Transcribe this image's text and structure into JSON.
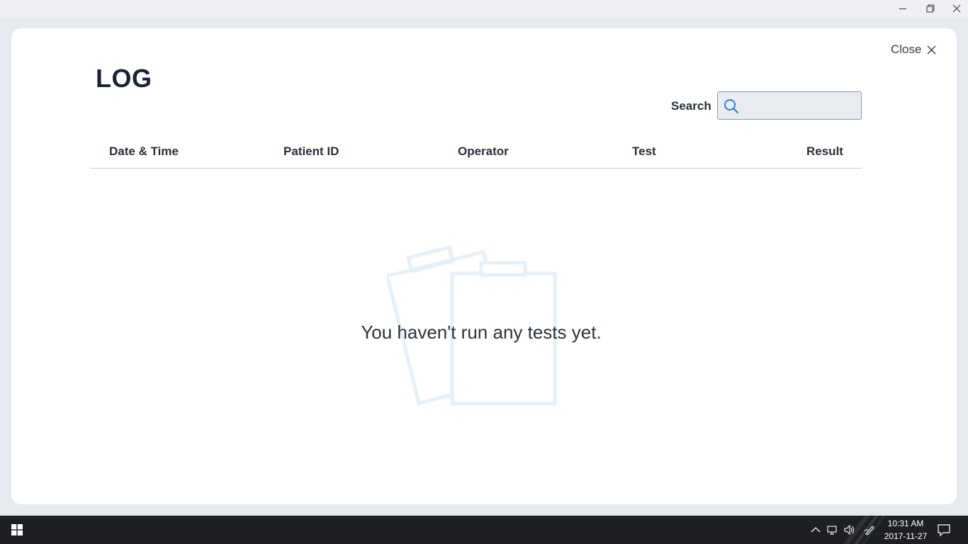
{
  "window": {
    "controls": [
      "minimize",
      "restore",
      "close"
    ]
  },
  "modal": {
    "close_label": "Close",
    "title": "LOG",
    "search": {
      "label": "Search",
      "value": "",
      "placeholder": ""
    },
    "table": {
      "columns": [
        "Date & Time",
        "Patient ID",
        "Operator",
        "Test",
        "Result"
      ],
      "rows": []
    },
    "empty_state": {
      "message": "You haven't run any tests yet.",
      "icon": "clipboard-icon"
    }
  },
  "taskbar": {
    "start_icon": "windows-logo-icon",
    "tray_icons": [
      "chevron-up-icon",
      "network-icon",
      "volume-icon",
      "pen-icon"
    ],
    "time": "10:31 AM",
    "date": "2017-11-27",
    "notification_icon": "action-center-icon"
  },
  "colors": {
    "accent": "#2f7fd8",
    "illustration": "#e6f0fa",
    "taskbar": "#1d1f22"
  }
}
